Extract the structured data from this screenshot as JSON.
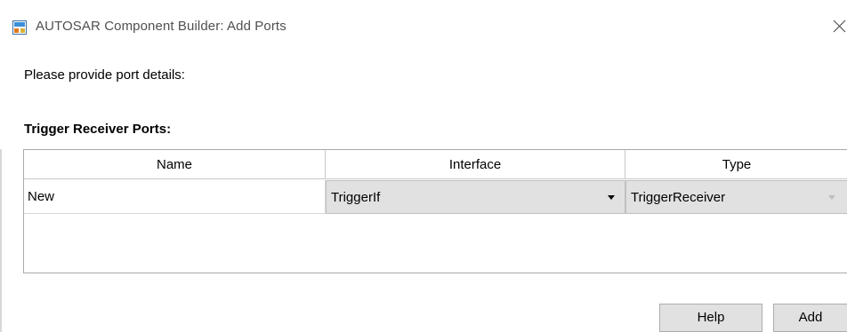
{
  "window": {
    "title": "AUTOSAR Component Builder: Add Ports",
    "app_icon": "simulink-app-icon",
    "close_icon": "close-icon"
  },
  "prompt": "Please provide port details:",
  "section": {
    "label": "Trigger Receiver Ports:"
  },
  "table": {
    "columns": [
      "Name",
      "Interface",
      "Type"
    ],
    "rows": [
      {
        "name": "New",
        "interface": "TriggerIf",
        "type": "TriggerReceiver"
      }
    ]
  },
  "buttons": {
    "help": "Help",
    "add": "Add"
  },
  "colors": {
    "cell_dropdown_bg": "#e1e1e1",
    "button_bg": "#e1e1e1",
    "grid_border": "#a9a9a9"
  }
}
